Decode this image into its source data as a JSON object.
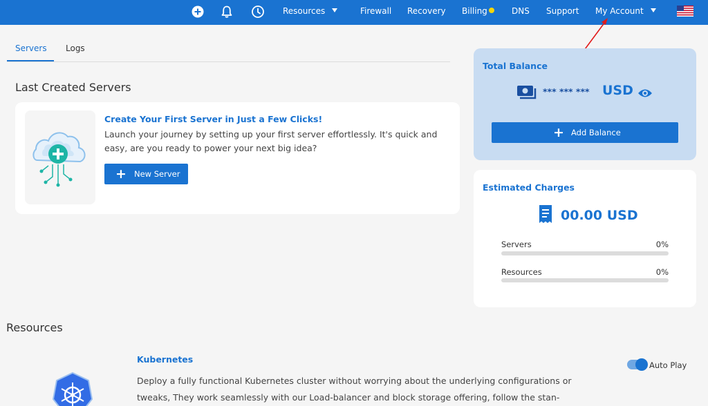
{
  "nav": {
    "icons": [
      "add-circle-icon",
      "bell-icon",
      "clock-icon"
    ],
    "resources": "Resources",
    "firewall": "Firewall",
    "recovery": "Recovery",
    "billing": "Billing",
    "dns": "DNS",
    "support": "Support",
    "my_account": "My Account",
    "flag": "us-flag-icon",
    "billing_dot_color": "#f5d60a"
  },
  "tabs": [
    "Servers",
    "Logs"
  ],
  "last_created": {
    "title": "Last Created Servers",
    "card_title": "Create Your First Server in Just a Few Clicks!",
    "card_desc": "Launch your journey by setting up your first server effortlessly. It's quick and easy, are you ready to power your next big idea?",
    "button": "New Server"
  },
  "balance": {
    "title": "Total Balance",
    "masked": "*** *** ***",
    "currency": "USD",
    "button": "Add Balance"
  },
  "charges": {
    "title": "Estimated Charges",
    "amount": "00.00 USD",
    "bars": [
      {
        "label": "Servers",
        "pct": "0%",
        "value": 0
      },
      {
        "label": "Resources",
        "pct": "0%",
        "value": 0
      }
    ]
  },
  "resources": {
    "title": "Resources",
    "item_title": "Kubernetes",
    "item_desc": "Deploy a fully functional Kubernetes cluster without worrying about the underlying configurations or tweaks, They work seamlessly with our Load-balancer and block storage offering, follow the stan-",
    "autoplay": "Auto Play"
  },
  "colors": {
    "primary": "#1a73d1",
    "balance_bg": "#c8dcf2"
  }
}
